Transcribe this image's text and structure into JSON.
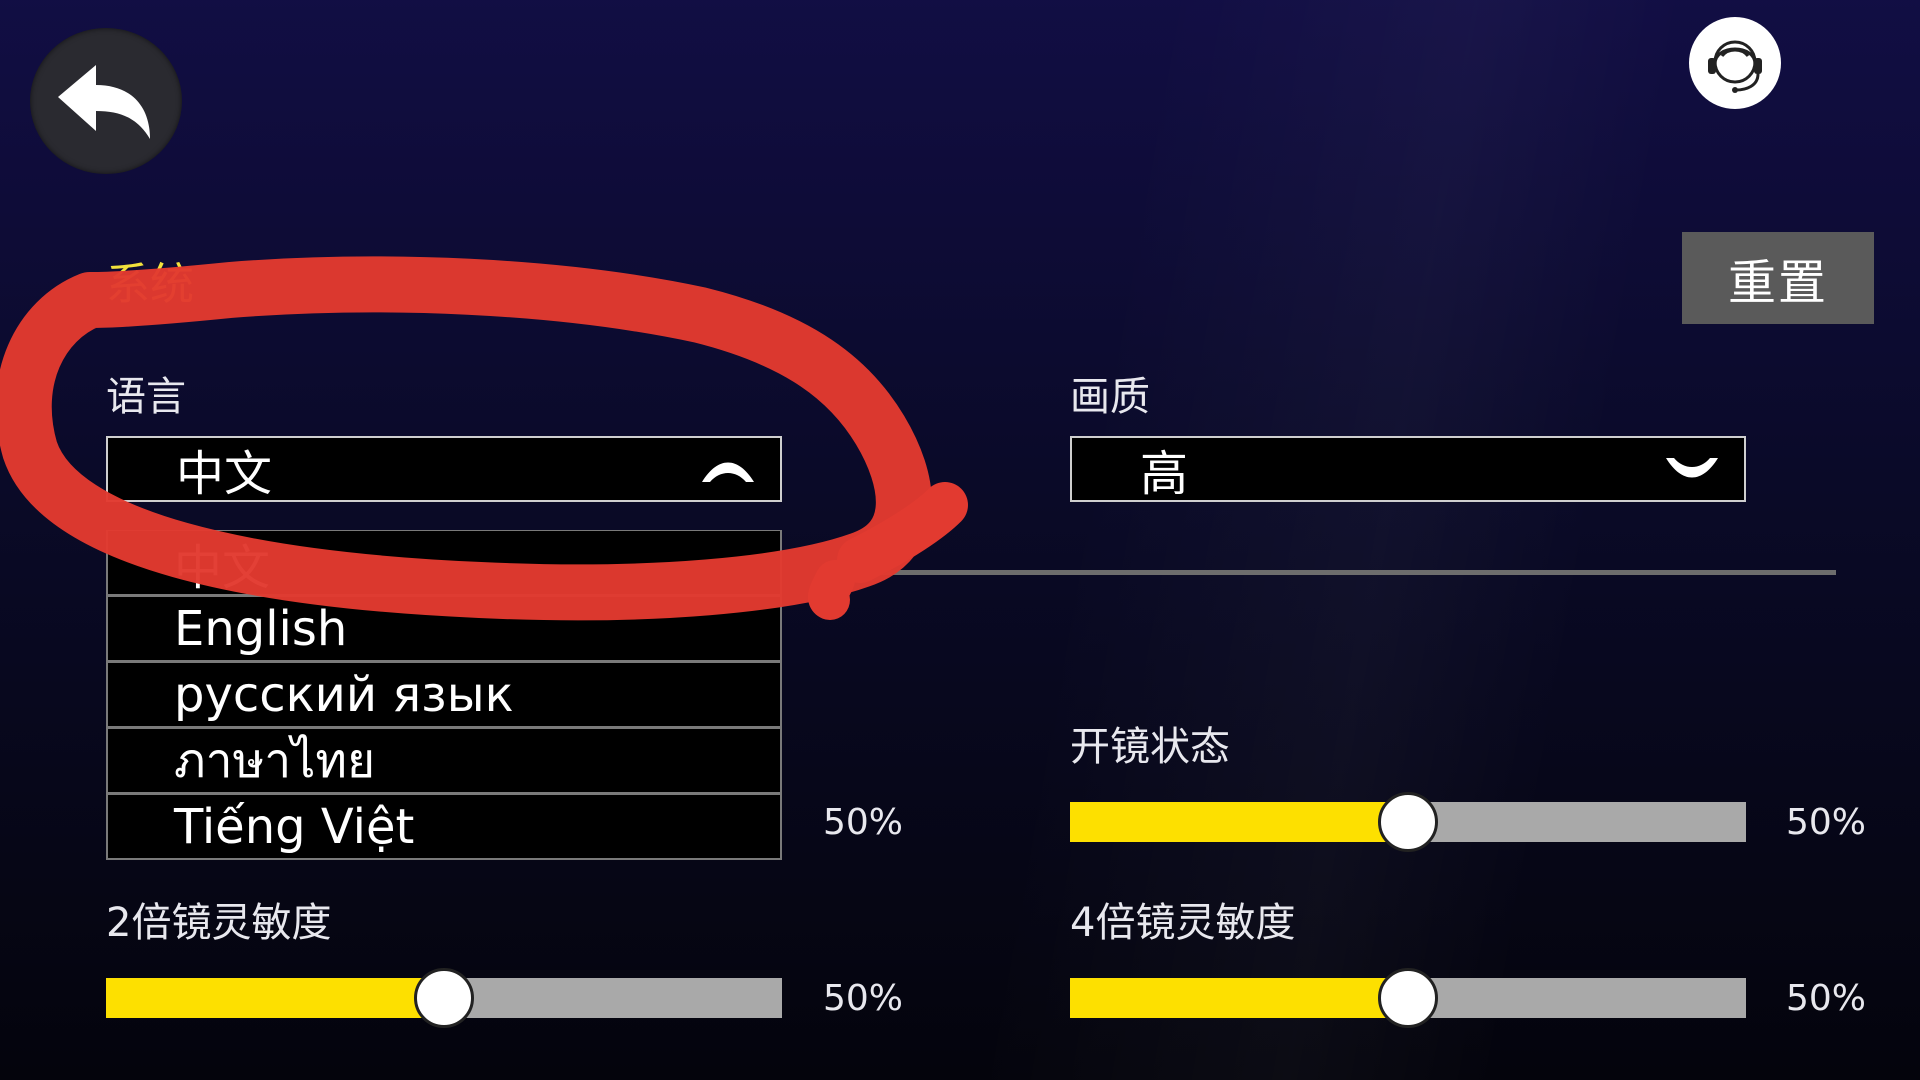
{
  "header": {
    "back_icon": "back-arrow-icon",
    "support_icon": "headset-support-icon",
    "reset_label": "重置"
  },
  "section": {
    "title": "系统"
  },
  "language": {
    "label": "语言",
    "selected": "中文",
    "expanded": true,
    "options": [
      "中文",
      "English",
      "русский язык",
      "ภาษาไทย",
      "Tiếng Việt"
    ]
  },
  "quality": {
    "label": "画质",
    "selected": "高",
    "expanded": false
  },
  "sliders": {
    "hidden_left_value": "50%",
    "scope_state": {
      "label": "开镜状态",
      "value_text": "50%",
      "value": 0.5
    },
    "scope2x": {
      "label": "2倍镜灵敏度",
      "value_text": "50%",
      "value": 0.5
    },
    "scope4x": {
      "label": "4倍镜灵敏度",
      "value_text": "50%",
      "value": 0.5
    }
  },
  "colors": {
    "section_title": "#f2e23c",
    "slider_fill": "#fde000",
    "slider_track": "#a9a9a9",
    "annotation": "#e23a30"
  }
}
